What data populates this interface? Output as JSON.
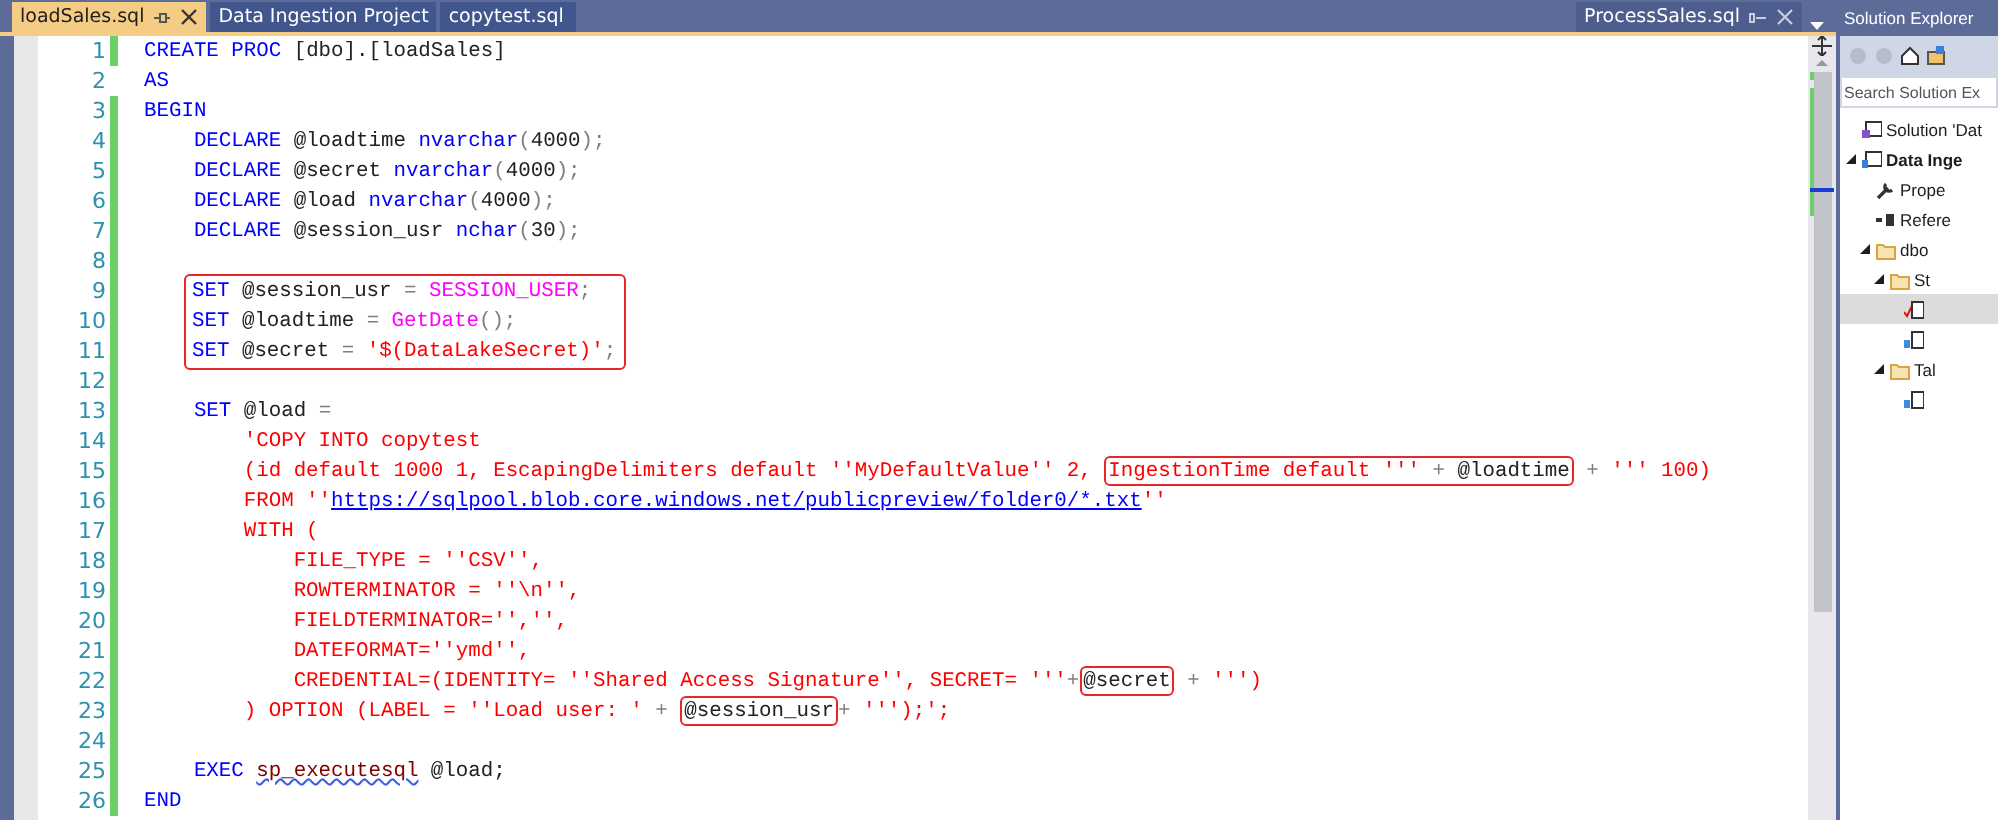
{
  "tabs": [
    {
      "label": "loadSales.sql",
      "selected": true,
      "pinnable": true
    },
    {
      "label": "Data Ingestion Project",
      "selected": false,
      "pinnable": false
    },
    {
      "label": "copytest.sql",
      "selected": false,
      "pinnable": false
    }
  ],
  "right_tab": {
    "label": "ProcessSales.sql"
  },
  "editor": {
    "lines": [
      {
        "number": "1",
        "changed": true,
        "boxed": false,
        "tokens": [
          {
            "kind": "keyword",
            "text": "CREATE PROC "
          },
          {
            "kind": "plain",
            "text": "[dbo].[loadSales]"
          }
        ]
      },
      {
        "number": "2",
        "changed": false,
        "boxed": false,
        "tokens": [
          {
            "kind": "keyword",
            "text": "AS"
          }
        ]
      },
      {
        "number": "3",
        "changed": true,
        "boxed": false,
        "tokens": [
          {
            "kind": "keyword",
            "text": "BEGIN"
          }
        ]
      },
      {
        "number": "4",
        "changed": true,
        "boxed": false,
        "tokens": [
          {
            "kind": "keyword",
            "text": "    DECLARE "
          },
          {
            "kind": "plain",
            "text": "@loadtime "
          },
          {
            "kind": "keyword",
            "text": "nvarchar"
          },
          {
            "kind": "operator",
            "text": "("
          },
          {
            "kind": "plain",
            "text": "4000"
          },
          {
            "kind": "operator",
            "text": ");"
          }
        ]
      },
      {
        "number": "5",
        "changed": true,
        "boxed": false,
        "tokens": [
          {
            "kind": "keyword",
            "text": "    DECLARE "
          },
          {
            "kind": "plain",
            "text": "@secret "
          },
          {
            "kind": "keyword",
            "text": "nvarchar"
          },
          {
            "kind": "operator",
            "text": "("
          },
          {
            "kind": "plain",
            "text": "4000"
          },
          {
            "kind": "operator",
            "text": ");"
          }
        ]
      },
      {
        "number": "6",
        "changed": true,
        "boxed": false,
        "tokens": [
          {
            "kind": "keyword",
            "text": "    DECLARE "
          },
          {
            "kind": "plain",
            "text": "@load "
          },
          {
            "kind": "keyword",
            "text": "nvarchar"
          },
          {
            "kind": "operator",
            "text": "("
          },
          {
            "kind": "plain",
            "text": "4000"
          },
          {
            "kind": "operator",
            "text": ");"
          }
        ]
      },
      {
        "number": "7",
        "changed": true,
        "boxed": false,
        "tokens": [
          {
            "kind": "keyword",
            "text": "    DECLARE "
          },
          {
            "kind": "plain",
            "text": "@session_usr "
          },
          {
            "kind": "keyword",
            "text": "nchar"
          },
          {
            "kind": "operator",
            "text": "("
          },
          {
            "kind": "plain",
            "text": "30"
          },
          {
            "kind": "operator",
            "text": ");"
          }
        ]
      },
      {
        "number": "8",
        "changed": true,
        "boxed": false
      },
      {
        "number": "9",
        "changed": true,
        "boxed": true,
        "tokens": [
          {
            "kind": "keyword",
            "text": "SET "
          },
          {
            "kind": "plain",
            "text": "@session_usr "
          },
          {
            "kind": "operator",
            "text": "= "
          },
          {
            "kind": "function",
            "text": "SESSION_USER"
          },
          {
            "kind": "operator",
            "text": ";"
          }
        ]
      },
      {
        "number": "10",
        "changed": true,
        "boxed": true,
        "tokens": [
          {
            "kind": "keyword",
            "text": "SET "
          },
          {
            "kind": "plain",
            "text": "@loadtime "
          },
          {
            "kind": "operator",
            "text": "= "
          },
          {
            "kind": "function",
            "text": "GetDate"
          },
          {
            "kind": "operator",
            "text": "();"
          }
        ]
      },
      {
        "number": "11",
        "changed": true,
        "boxed": true,
        "tokens": [
          {
            "kind": "keyword",
            "text": "SET "
          },
          {
            "kind": "plain",
            "text": "@secret "
          },
          {
            "kind": "operator",
            "text": "= "
          },
          {
            "kind": "string",
            "text": "'$(DataLakeSecret)'"
          },
          {
            "kind": "operator",
            "text": ";"
          }
        ]
      },
      {
        "number": "12",
        "changed": true,
        "boxed": false
      },
      {
        "number": "13",
        "changed": true,
        "boxed": false,
        "tokens": [
          {
            "kind": "keyword",
            "text": "    SET "
          },
          {
            "kind": "plain",
            "text": "@load "
          },
          {
            "kind": "operator",
            "text": "="
          }
        ]
      },
      {
        "number": "14",
        "changed": true,
        "boxed": false,
        "tokens": [
          {
            "kind": "string",
            "text": "        'COPY INTO copytest"
          }
        ]
      },
      {
        "number": "15",
        "changed": true,
        "boxed": false,
        "tokens": [
          {
            "kind": "string",
            "text": "        (id default 1000 1, EscapingDelimiters default ''MyDefaultValue'' 2, "
          },
          {
            "kind": "box",
            "tokens": [
              {
                "kind": "string",
                "text": "IngestionTime default ''' "
              },
              {
                "kind": "operator",
                "text": "+ "
              },
              {
                "kind": "plain",
                "text": "@loadtime"
              }
            ]
          },
          {
            "kind": "operator",
            "text": " + "
          },
          {
            "kind": "string",
            "text": "''' 100)"
          }
        ]
      },
      {
        "number": "16",
        "changed": true,
        "boxed": false,
        "tokens": [
          {
            "kind": "string",
            "text": "        FROM ''"
          },
          {
            "kind": "link",
            "text": "https://sqlpool.blob.core.windows.net/publicpreview/folder0/*.txt"
          },
          {
            "kind": "string",
            "text": "''"
          }
        ]
      },
      {
        "number": "17",
        "changed": true,
        "boxed": false,
        "tokens": [
          {
            "kind": "string",
            "text": "        WITH ("
          }
        ]
      },
      {
        "number": "18",
        "changed": true,
        "boxed": false,
        "tokens": [
          {
            "kind": "string",
            "text": "            FILE_TYPE = ''CSV'',"
          }
        ]
      },
      {
        "number": "19",
        "changed": true,
        "boxed": false,
        "tokens": [
          {
            "kind": "string",
            "text": "            ROWTERMINATOR = ''\\n'',"
          }
        ]
      },
      {
        "number": "20",
        "changed": true,
        "boxed": false,
        "tokens": [
          {
            "kind": "string",
            "text": "            FIELDTERMINATOR='','',"
          }
        ]
      },
      {
        "number": "21",
        "changed": true,
        "boxed": false,
        "tokens": [
          {
            "kind": "string",
            "text": "            DATEFORMAT=''ymd'',"
          }
        ]
      },
      {
        "number": "22",
        "changed": true,
        "boxed": false,
        "tokens": [
          {
            "kind": "string",
            "text": "            CREDENTIAL=(IDENTITY= ''Shared Access Signature'', SECRET= '''"
          },
          {
            "kind": "operator",
            "text": "+"
          },
          {
            "kind": "box",
            "tokens": [
              {
                "kind": "plain",
                "text": "@secret"
              }
            ]
          },
          {
            "kind": "operator",
            "text": " + "
          },
          {
            "kind": "string",
            "text": "''')"
          }
        ]
      },
      {
        "number": "23",
        "changed": true,
        "boxed": false,
        "tokens": [
          {
            "kind": "string",
            "text": "        ) OPTION (LABEL = ''Load user: ' "
          },
          {
            "kind": "operator",
            "text": "+ "
          },
          {
            "kind": "box",
            "tokens": [
              {
                "kind": "plain",
                "text": "@session_usr"
              }
            ]
          },
          {
            "kind": "operator",
            "text": "+ "
          },
          {
            "kind": "string",
            "text": "''');';"
          }
        ]
      },
      {
        "number": "24",
        "changed": true,
        "boxed": false
      },
      {
        "number": "25",
        "changed": true,
        "boxed": false,
        "tokens": [
          {
            "kind": "keyword",
            "text": "    EXEC "
          },
          {
            "kind": "proc",
            "text": "sp_executesql"
          },
          {
            "kind": "plain",
            "text": " @load;"
          }
        ]
      },
      {
        "number": "26",
        "changed": true,
        "boxed": false,
        "tokens": [
          {
            "kind": "keyword",
            "text": "END"
          }
        ]
      }
    ]
  },
  "solution_explorer": {
    "title": "Solution Explorer",
    "search": {
      "placeholder": "Search Solution Ex"
    },
    "tree": [
      {
        "label": "Solution 'Dat",
        "kind": "solution",
        "bold": false,
        "selected": false,
        "expanded": false
      },
      {
        "label": "Data Inge",
        "kind": "project",
        "bold": true,
        "selected": false,
        "expanded": true,
        "children": [
          {
            "label": "Prope",
            "kind": "properties",
            "bold": false,
            "selected": false,
            "expanded": false
          },
          {
            "label": "Refere",
            "kind": "references",
            "bold": false,
            "selected": false,
            "expanded": false
          },
          {
            "label": "dbo",
            "kind": "folder",
            "bold": false,
            "selected": false,
            "expanded": true,
            "children": [
              {
                "label": "St",
                "kind": "folder",
                "bold": false,
                "selected": false,
                "expanded": true,
                "children": [
                  {
                    "kind": "file",
                    "edited": true,
                    "selected": true,
                    "expanded": false
                  },
                  {
                    "kind": "file",
                    "edited": false,
                    "selected": false,
                    "expanded": false
                  }
                ]
              },
              {
                "label": "Tal",
                "kind": "folder",
                "bold": false,
                "selected": false,
                "expanded": true,
                "children": [
                  {
                    "kind": "file",
                    "edited": false,
                    "selected": false,
                    "expanded": false
                  }
                ]
              }
            ]
          }
        ]
      }
    ]
  }
}
